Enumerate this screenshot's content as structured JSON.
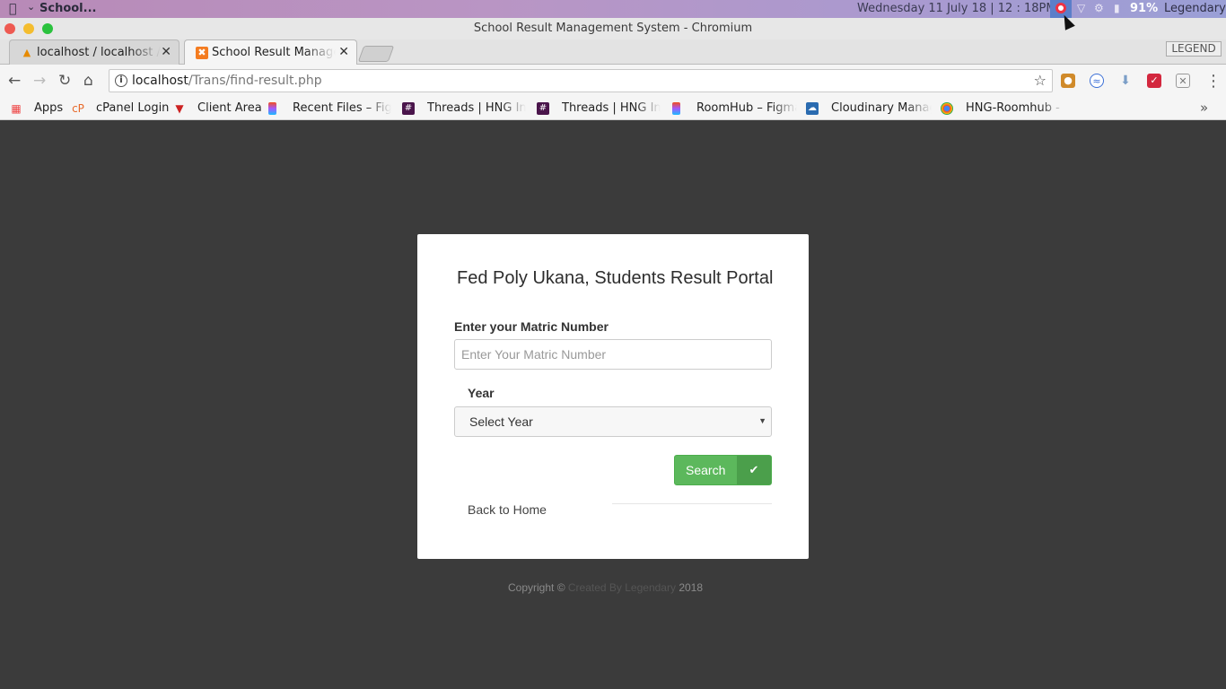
{
  "menubar": {
    "app_name": "School...",
    "datetime": "Wednesday 11 July 18 |  12 : 18PM",
    "battery": "91%",
    "user": "Legendary"
  },
  "window": {
    "title": "School Result Management System - Chromium"
  },
  "tabs": [
    {
      "label": "localhost / localhost / t",
      "favicon": "phpmyadmin-icon"
    },
    {
      "label": "School Result Manager",
      "favicon": "xampp-icon"
    }
  ],
  "extension_badge": "LEGEND",
  "address": {
    "host": "localhost",
    "path": "/Trans/find-result.php"
  },
  "bookmarks": [
    {
      "label": "Apps",
      "icon": "apps-grid-icon"
    },
    {
      "label": "cPanel Login",
      "icon": "cpanel-icon"
    },
    {
      "label": "Client Area",
      "icon": "shield-icon"
    },
    {
      "label": "Recent Files – Figm",
      "icon": "figma-icon"
    },
    {
      "label": "Threads | HNG Inte",
      "icon": "hash-icon"
    },
    {
      "label": "Threads | HNG Inte",
      "icon": "hash-icon"
    },
    {
      "label": "RoomHub – Figma",
      "icon": "figma-icon"
    },
    {
      "label": "Cloudinary Manag",
      "icon": "cloudinary-icon"
    },
    {
      "label": "HNG-Roomhub - F",
      "icon": "chrome-icon"
    }
  ],
  "form": {
    "title": "Fed Poly Ukana, Students Result Portal",
    "matric_label": "Enter your Matric Number",
    "matric_placeholder": "Enter Your Matric Number",
    "matric_value": "",
    "year_label": "Year",
    "year_selected": "Select Year",
    "search_label": "Search",
    "back_link": "Back to Home"
  },
  "footer": {
    "prefix": "Copyright ©",
    "credit": "Created By Legendary",
    "year": "2018"
  },
  "colors": {
    "page_bg": "#3b3b3b",
    "card_bg": "#ffffff",
    "button_green": "#5cb85c",
    "button_check": "#4b9f4b"
  }
}
